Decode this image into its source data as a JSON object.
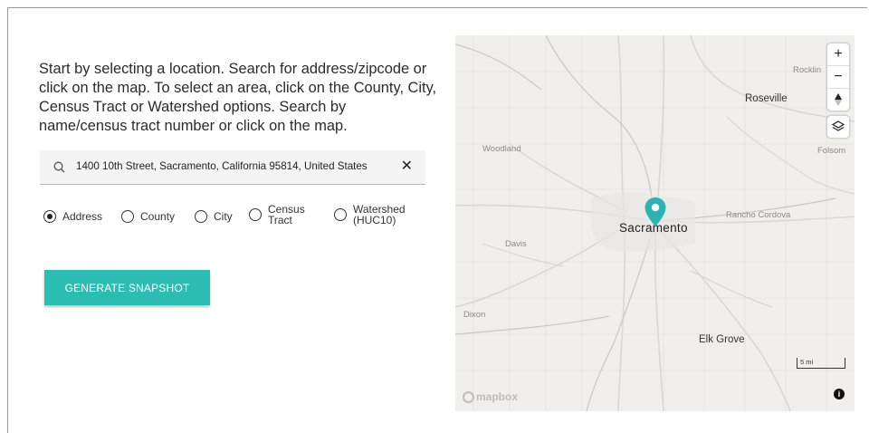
{
  "intro_text": "Start by selecting a location. Search for address/zipcode or click on the map. To select an area, click on the County, City, Census Tract or Watershed options. Search by name/census tract number or click on the map.",
  "search": {
    "value": "1400 10th Street, Sacramento, California 95814, United States",
    "clear_label": "✕"
  },
  "radios": [
    {
      "label": "Address",
      "checked": true
    },
    {
      "label": "County",
      "checked": false
    },
    {
      "label": "City",
      "checked": false
    },
    {
      "label": "Census\nTract",
      "checked": false
    },
    {
      "label": "Watershed\n(HUC10)",
      "checked": false
    }
  ],
  "generate_button": "GENERATE SNAPSHOT",
  "map": {
    "places": {
      "rocklin": "Rocklin",
      "roseville": "Roseville",
      "woodland": "Woodland",
      "folsom": "Folsom",
      "rancho_cordova": "Rancho Cordova",
      "davis": "Davis",
      "sacramento": "Sacramento",
      "dixon": "Dixon",
      "elk_grove": "Elk Grove"
    },
    "controls": {
      "zoom_in": "+",
      "zoom_out": "−",
      "compass": "▲",
      "layers": "layers"
    },
    "scale_label": "5 mi",
    "attribution_logo": "mapbox",
    "info": "i",
    "pin_color": "#2bb3b3"
  }
}
